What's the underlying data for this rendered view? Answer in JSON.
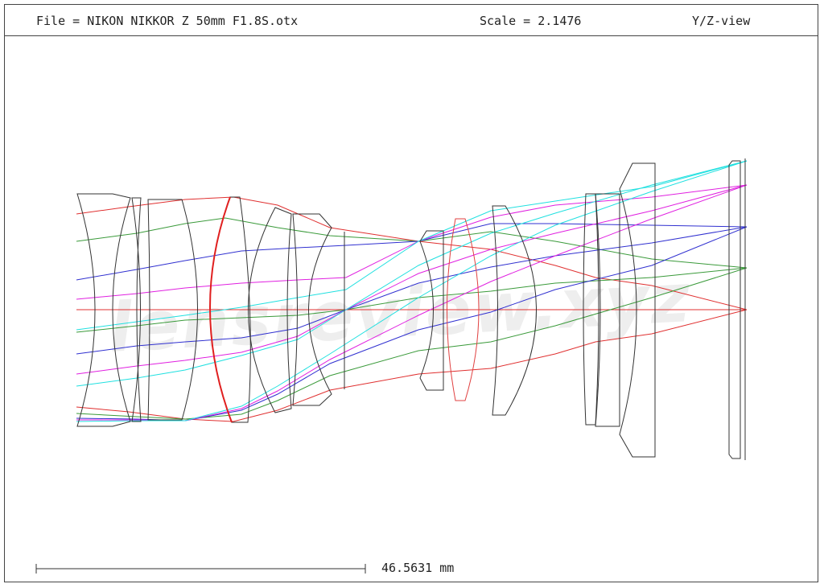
{
  "header": {
    "file": "File = NIKON NIKKOR Z 50mm F1.8S.otx",
    "scale": "Scale = 2.1476",
    "view": "Y/Z-view"
  },
  "scale_bar": {
    "label": "46.5631 mm"
  },
  "watermark": "lensreview.xyz",
  "colors": {
    "frame": "#444444",
    "element_outline": "#333333",
    "highlight_surface": "#e02020",
    "ray_red": "#e03030",
    "ray_green": "#3a9a3a",
    "ray_blue": "#3030d0",
    "ray_magenta": "#e020e0",
    "ray_cyan": "#20e0e0"
  }
}
